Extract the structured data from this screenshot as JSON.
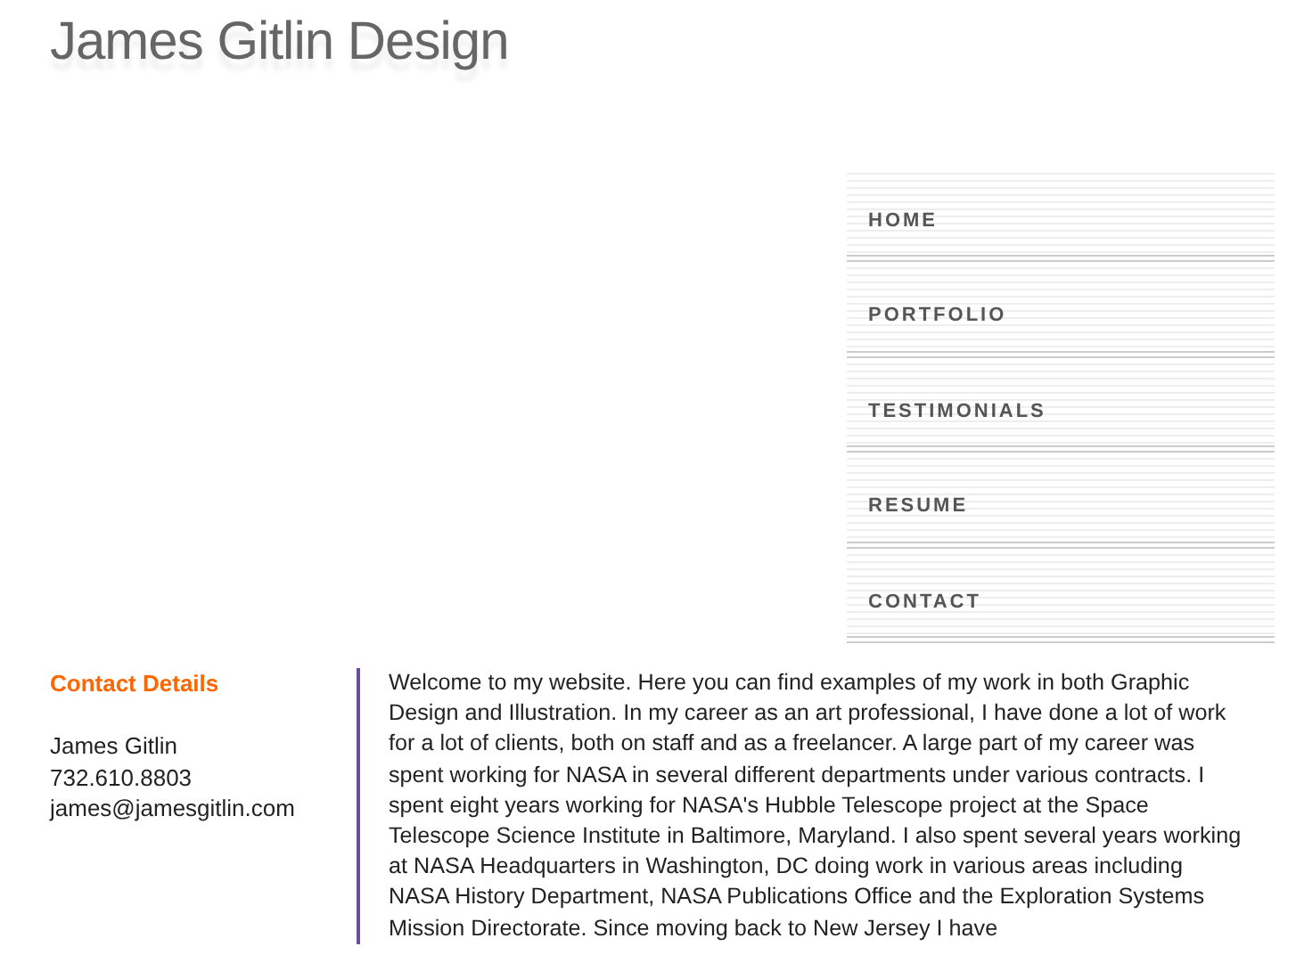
{
  "site_title": "James Gitlin Design",
  "nav": [
    {
      "label": "HOME"
    },
    {
      "label": "PORTFOLIO"
    },
    {
      "label": "TESTIMONIALS"
    },
    {
      "label": "RESUME"
    },
    {
      "label": "CONTACT"
    }
  ],
  "contact": {
    "heading": "Contact Details",
    "lines": [
      "James Gitlin",
      "732.610.8803",
      "james@jamesgitlin.com"
    ]
  },
  "intro": "Welcome to my website. Here you can find examples of my work in both Graphic Design and Illustration. In my career as an art professional, I have done a lot of work for a lot of clients, both on staff and as a freelancer. A large part of my career was spent working for NASA in several different departments under various contracts. I spent eight years working for NASA's Hubble Telescope project at the Space Telescope Science Institute in Baltimore, Maryland. I also spent several years working at NASA Headquarters in Washington, DC doing work in various areas including NASA History Department, NASA Publications Office and the Exploration Systems Mission Directorate. Since moving back to New Jersey I have"
}
